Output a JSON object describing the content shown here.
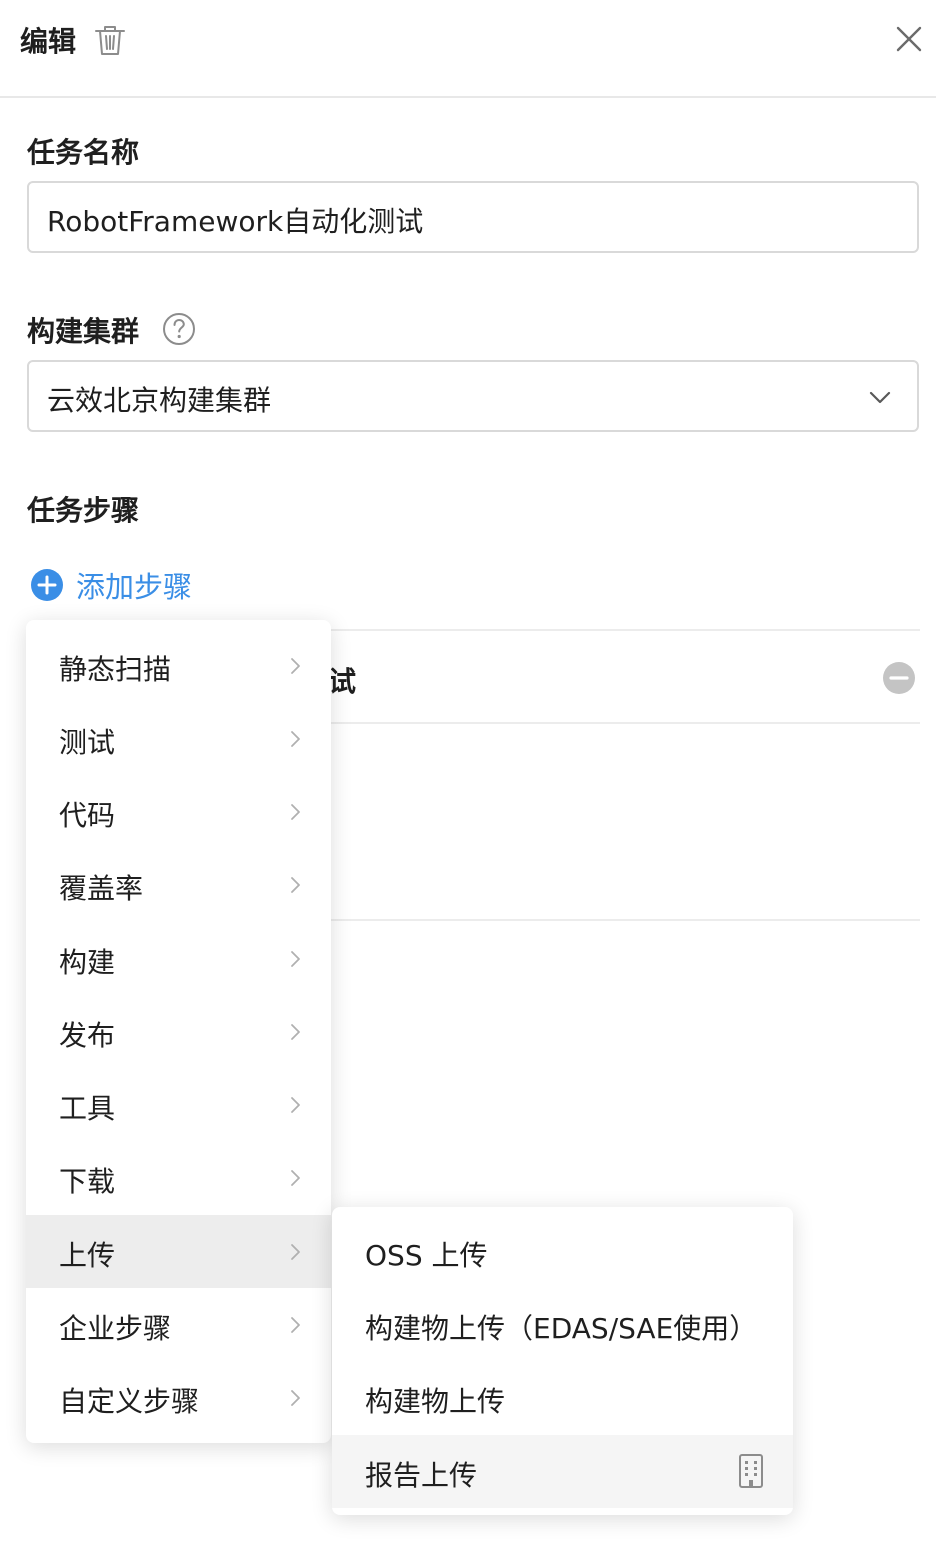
{
  "header": {
    "title": "编辑"
  },
  "task_name": {
    "label": "任务名称",
    "value": "RobotFramework自动化测试"
  },
  "build_cluster": {
    "label": "构建集群",
    "value": "云效北京构建集群"
  },
  "task_steps": {
    "label": "任务步骤",
    "add_label": "添加步骤",
    "step_name_fragment": "试"
  },
  "menu": {
    "items": [
      {
        "label": "静态扫描"
      },
      {
        "label": "测试"
      },
      {
        "label": "代码"
      },
      {
        "label": "覆盖率"
      },
      {
        "label": "构建"
      },
      {
        "label": "发布"
      },
      {
        "label": "工具"
      },
      {
        "label": "下载"
      },
      {
        "label": "上传"
      },
      {
        "label": "企业步骤"
      },
      {
        "label": "自定义步骤"
      }
    ],
    "active_index": 8
  },
  "submenu": {
    "items": [
      {
        "label": "OSS 上传"
      },
      {
        "label": "构建物上传（EDAS/SAE使用）"
      },
      {
        "label": "构建物上传"
      },
      {
        "label": "报告上传"
      }
    ]
  },
  "colors": {
    "accent": "#3a8ee6",
    "remove": "#c4c4c4"
  }
}
